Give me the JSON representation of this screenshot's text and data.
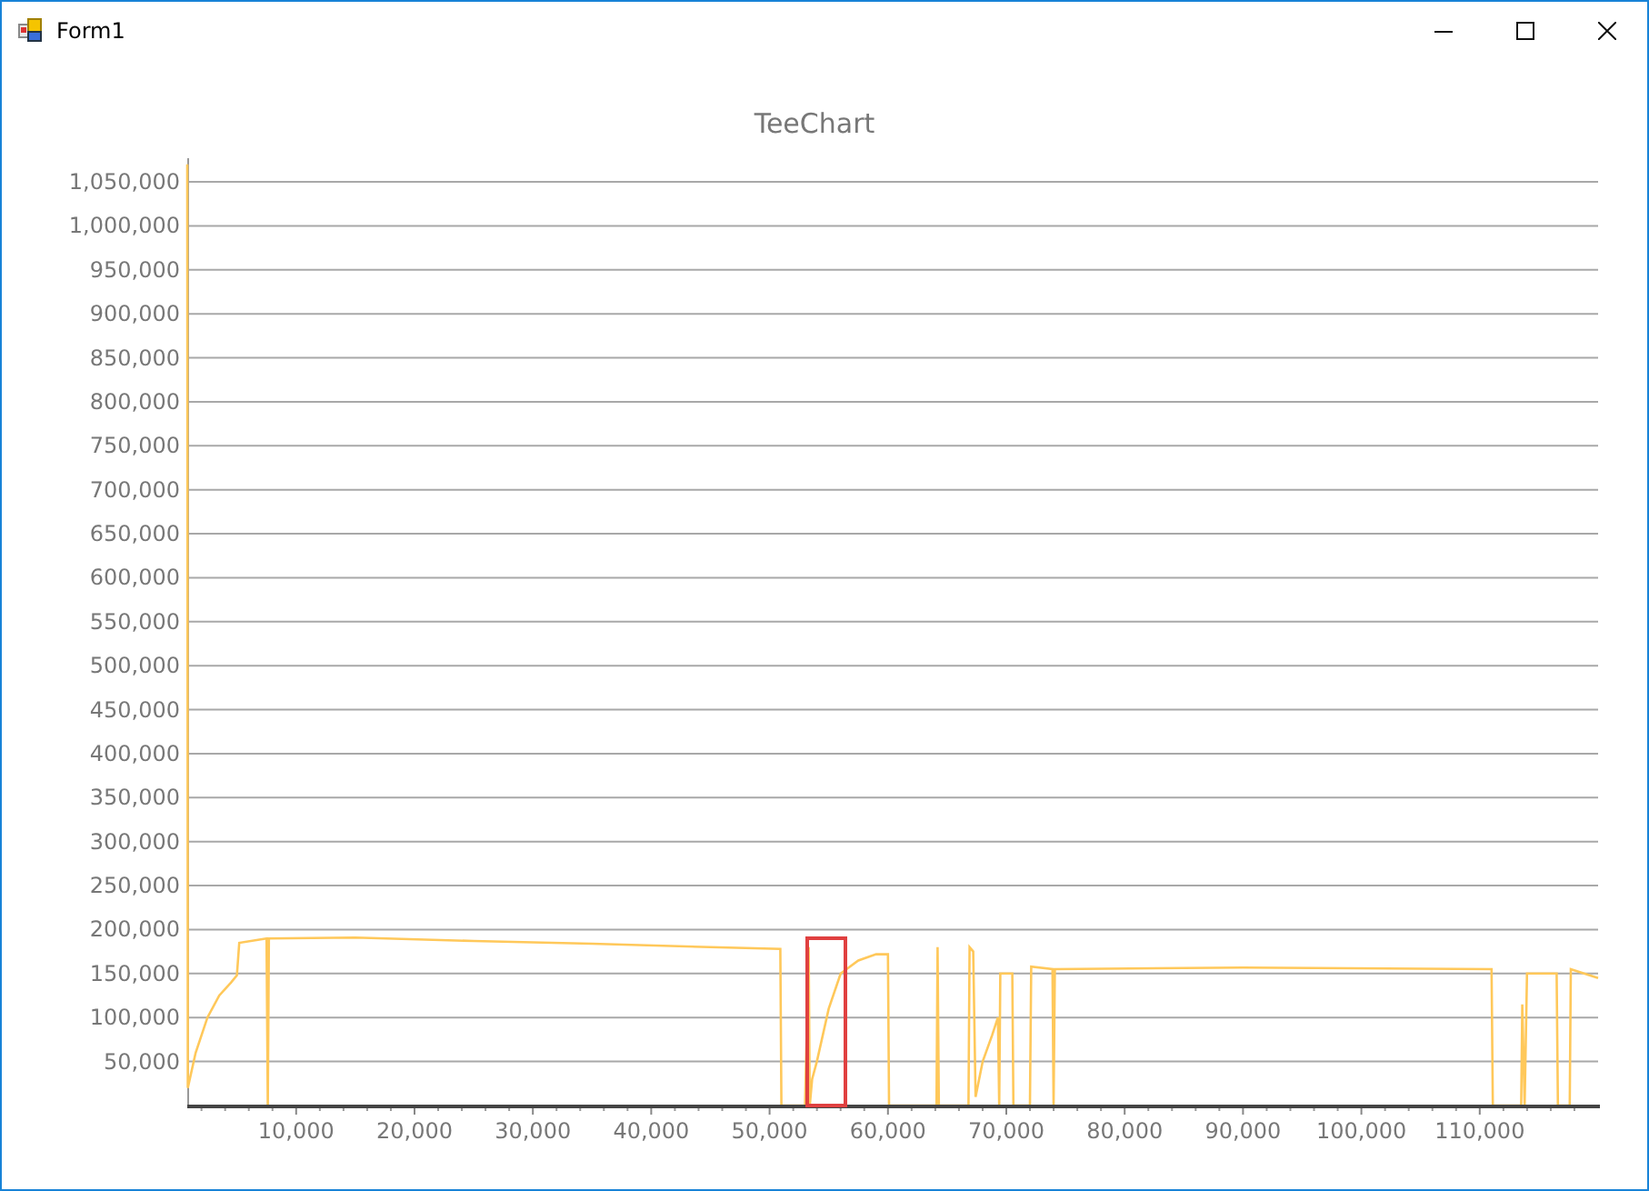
{
  "window": {
    "title": "Form1"
  },
  "chart": {
    "chart_data": {
      "type": "line",
      "title": "TeeChart",
      "xlim": [
        800,
        120000
      ],
      "ylim": [
        0,
        1077000
      ],
      "xticks": [
        {
          "value": 10000,
          "label": "10,000"
        },
        {
          "value": 20000,
          "label": "20,000"
        },
        {
          "value": 30000,
          "label": "30,000"
        },
        {
          "value": 40000,
          "label": "40,000"
        },
        {
          "value": 50000,
          "label": "50,000"
        },
        {
          "value": 60000,
          "label": "60,000"
        },
        {
          "value": 70000,
          "label": "70,000"
        },
        {
          "value": 80000,
          "label": "80,000"
        },
        {
          "value": 90000,
          "label": "90,000"
        },
        {
          "value": 100000,
          "label": "100,000"
        },
        {
          "value": 110000,
          "label": "110,000"
        }
      ],
      "yticks": [
        {
          "value": 50000,
          "label": "50,000"
        },
        {
          "value": 100000,
          "label": "100,000"
        },
        {
          "value": 150000,
          "label": "150,000"
        },
        {
          "value": 200000,
          "label": "200,000"
        },
        {
          "value": 250000,
          "label": "250,000"
        },
        {
          "value": 300000,
          "label": "300,000"
        },
        {
          "value": 350000,
          "label": "350,000"
        },
        {
          "value": 400000,
          "label": "400,000"
        },
        {
          "value": 450000,
          "label": "450,000"
        },
        {
          "value": 500000,
          "label": "500,000"
        },
        {
          "value": 550000,
          "label": "550,000"
        },
        {
          "value": 600000,
          "label": "600,000"
        },
        {
          "value": 650000,
          "label": "650,000"
        },
        {
          "value": 700000,
          "label": "700,000"
        },
        {
          "value": 750000,
          "label": "750,000"
        },
        {
          "value": 800000,
          "label": "800,000"
        },
        {
          "value": 850000,
          "label": "850,000"
        },
        {
          "value": 900000,
          "label": "900,000"
        },
        {
          "value": 950000,
          "label": "950,000"
        },
        {
          "value": 1000000,
          "label": "1,000,000"
        },
        {
          "value": 1050000,
          "label": "1,050,000"
        }
      ],
      "x": [
        800,
        850,
        1500,
        2500,
        3500,
        4500,
        5000,
        5200,
        7500,
        7600,
        7700,
        15000,
        25000,
        35000,
        45000,
        50900,
        51000,
        53000,
        53300,
        53400,
        53600,
        54000,
        55000,
        56000,
        57500,
        59000,
        60000,
        60100,
        64100,
        64200,
        64300,
        66800,
        66900,
        67200,
        67400,
        68000,
        68800,
        69300,
        69400,
        69500,
        70500,
        70600,
        72000,
        72100,
        73900,
        74000,
        74100,
        90000,
        111000,
        111100,
        113500,
        113600,
        113800,
        114000,
        116500,
        116600,
        117600,
        117700,
        120000
      ],
      "series": [
        {
          "color": "#ffc85a",
          "values": [
            1070000,
            20000,
            60000,
            100000,
            125000,
            140000,
            148000,
            185000,
            190000,
            0,
            190000,
            191000,
            187000,
            184000,
            180000,
            178000,
            0,
            0,
            180000,
            0,
            30000,
            50000,
            110000,
            150000,
            165000,
            172000,
            172000,
            0,
            0,
            180000,
            0,
            0,
            180000,
            175000,
            10000,
            50000,
            80000,
            100000,
            0,
            150000,
            150000,
            0,
            0,
            158000,
            155000,
            0,
            155000,
            157000,
            155000,
            0,
            0,
            115000,
            0,
            150000,
            150000,
            0,
            0,
            155000,
            145000
          ]
        }
      ],
      "grid": true
    }
  }
}
